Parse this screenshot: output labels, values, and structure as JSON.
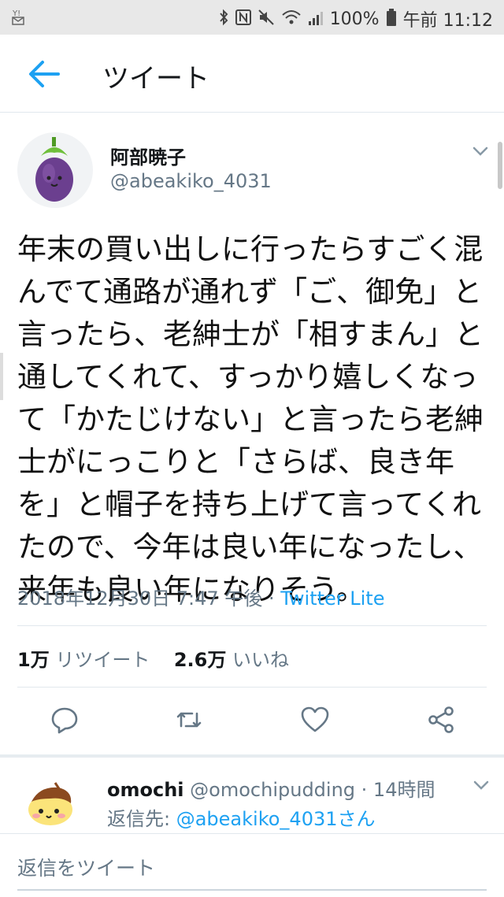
{
  "status_bar": {
    "carrier_icon": "y-mail-icon",
    "battery": "100%",
    "time": "午前 11:12"
  },
  "header": {
    "title": "ツイート"
  },
  "tweet": {
    "author_name": "阿部暁子",
    "author_handle": "@abeakiko_4031",
    "text": "年末の買い出しに行ったらすごく混\nんでて通路が通れず「ご、御免」と\n言ったら、老紳士が「相すまん」と\n通してくれて、すっかり嬉しくなっ\nて「かたじけない」と言ったら老紳\n士がにっこりと「さらば、良き年\nを」と帽子を持ち上げて言ってくれ\nたので、今年は良い年になったし、\n来年も良い年になりそう。",
    "timestamp": "2018年12月30日 7:47 午後",
    "separator": " · ",
    "via": "Twitter Lite",
    "retweet_count": "1万",
    "retweet_label": "リツイート",
    "like_count": "2.6万",
    "like_label": "いいね"
  },
  "reply": {
    "name": "omochi",
    "handle": "@omochipudding",
    "time": " · 14時間",
    "reply_to_label": "返信先: ",
    "reply_to_handle": "@abeakiko_4031さん"
  },
  "compose": {
    "placeholder": "返信をツイート"
  },
  "colors": {
    "accent": "#1da1f2",
    "secondary_text": "#657786",
    "divider": "#e1e8ed"
  }
}
